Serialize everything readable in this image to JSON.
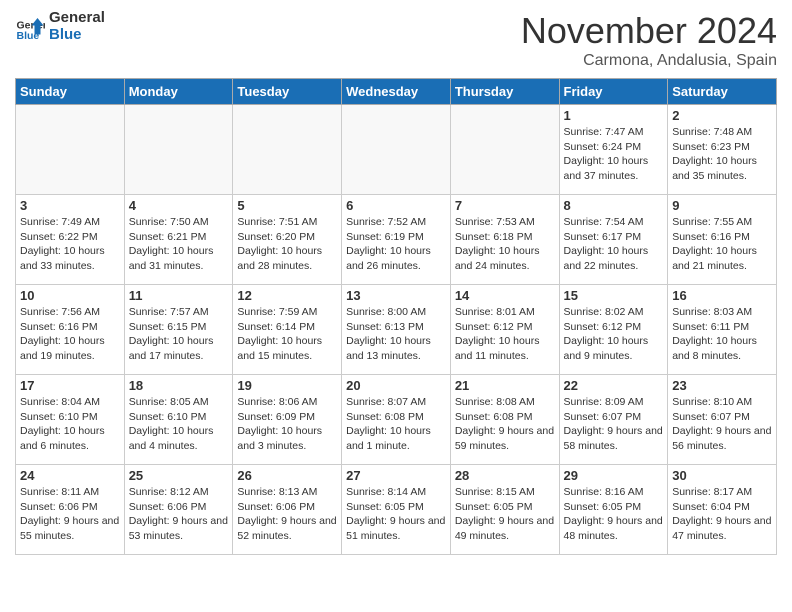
{
  "header": {
    "logo_line1": "General",
    "logo_line2": "Blue",
    "month_title": "November 2024",
    "location": "Carmona, Andalusia, Spain"
  },
  "weekdays": [
    "Sunday",
    "Monday",
    "Tuesday",
    "Wednesday",
    "Thursday",
    "Friday",
    "Saturday"
  ],
  "weeks": [
    [
      {
        "day": "",
        "info": "",
        "empty": true
      },
      {
        "day": "",
        "info": "",
        "empty": true
      },
      {
        "day": "",
        "info": "",
        "empty": true
      },
      {
        "day": "",
        "info": "",
        "empty": true
      },
      {
        "day": "",
        "info": "",
        "empty": true
      },
      {
        "day": "1",
        "info": "Sunrise: 7:47 AM\nSunset: 6:24 PM\nDaylight: 10 hours and 37 minutes.",
        "empty": false
      },
      {
        "day": "2",
        "info": "Sunrise: 7:48 AM\nSunset: 6:23 PM\nDaylight: 10 hours and 35 minutes.",
        "empty": false
      }
    ],
    [
      {
        "day": "3",
        "info": "Sunrise: 7:49 AM\nSunset: 6:22 PM\nDaylight: 10 hours and 33 minutes.",
        "empty": false
      },
      {
        "day": "4",
        "info": "Sunrise: 7:50 AM\nSunset: 6:21 PM\nDaylight: 10 hours and 31 minutes.",
        "empty": false
      },
      {
        "day": "5",
        "info": "Sunrise: 7:51 AM\nSunset: 6:20 PM\nDaylight: 10 hours and 28 minutes.",
        "empty": false
      },
      {
        "day": "6",
        "info": "Sunrise: 7:52 AM\nSunset: 6:19 PM\nDaylight: 10 hours and 26 minutes.",
        "empty": false
      },
      {
        "day": "7",
        "info": "Sunrise: 7:53 AM\nSunset: 6:18 PM\nDaylight: 10 hours and 24 minutes.",
        "empty": false
      },
      {
        "day": "8",
        "info": "Sunrise: 7:54 AM\nSunset: 6:17 PM\nDaylight: 10 hours and 22 minutes.",
        "empty": false
      },
      {
        "day": "9",
        "info": "Sunrise: 7:55 AM\nSunset: 6:16 PM\nDaylight: 10 hours and 21 minutes.",
        "empty": false
      }
    ],
    [
      {
        "day": "10",
        "info": "Sunrise: 7:56 AM\nSunset: 6:16 PM\nDaylight: 10 hours and 19 minutes.",
        "empty": false
      },
      {
        "day": "11",
        "info": "Sunrise: 7:57 AM\nSunset: 6:15 PM\nDaylight: 10 hours and 17 minutes.",
        "empty": false
      },
      {
        "day": "12",
        "info": "Sunrise: 7:59 AM\nSunset: 6:14 PM\nDaylight: 10 hours and 15 minutes.",
        "empty": false
      },
      {
        "day": "13",
        "info": "Sunrise: 8:00 AM\nSunset: 6:13 PM\nDaylight: 10 hours and 13 minutes.",
        "empty": false
      },
      {
        "day": "14",
        "info": "Sunrise: 8:01 AM\nSunset: 6:12 PM\nDaylight: 10 hours and 11 minutes.",
        "empty": false
      },
      {
        "day": "15",
        "info": "Sunrise: 8:02 AM\nSunset: 6:12 PM\nDaylight: 10 hours and 9 minutes.",
        "empty": false
      },
      {
        "day": "16",
        "info": "Sunrise: 8:03 AM\nSunset: 6:11 PM\nDaylight: 10 hours and 8 minutes.",
        "empty": false
      }
    ],
    [
      {
        "day": "17",
        "info": "Sunrise: 8:04 AM\nSunset: 6:10 PM\nDaylight: 10 hours and 6 minutes.",
        "empty": false
      },
      {
        "day": "18",
        "info": "Sunrise: 8:05 AM\nSunset: 6:10 PM\nDaylight: 10 hours and 4 minutes.",
        "empty": false
      },
      {
        "day": "19",
        "info": "Sunrise: 8:06 AM\nSunset: 6:09 PM\nDaylight: 10 hours and 3 minutes.",
        "empty": false
      },
      {
        "day": "20",
        "info": "Sunrise: 8:07 AM\nSunset: 6:08 PM\nDaylight: 10 hours and 1 minute.",
        "empty": false
      },
      {
        "day": "21",
        "info": "Sunrise: 8:08 AM\nSunset: 6:08 PM\nDaylight: 9 hours and 59 minutes.",
        "empty": false
      },
      {
        "day": "22",
        "info": "Sunrise: 8:09 AM\nSunset: 6:07 PM\nDaylight: 9 hours and 58 minutes.",
        "empty": false
      },
      {
        "day": "23",
        "info": "Sunrise: 8:10 AM\nSunset: 6:07 PM\nDaylight: 9 hours and 56 minutes.",
        "empty": false
      }
    ],
    [
      {
        "day": "24",
        "info": "Sunrise: 8:11 AM\nSunset: 6:06 PM\nDaylight: 9 hours and 55 minutes.",
        "empty": false
      },
      {
        "day": "25",
        "info": "Sunrise: 8:12 AM\nSunset: 6:06 PM\nDaylight: 9 hours and 53 minutes.",
        "empty": false
      },
      {
        "day": "26",
        "info": "Sunrise: 8:13 AM\nSunset: 6:06 PM\nDaylight: 9 hours and 52 minutes.",
        "empty": false
      },
      {
        "day": "27",
        "info": "Sunrise: 8:14 AM\nSunset: 6:05 PM\nDaylight: 9 hours and 51 minutes.",
        "empty": false
      },
      {
        "day": "28",
        "info": "Sunrise: 8:15 AM\nSunset: 6:05 PM\nDaylight: 9 hours and 49 minutes.",
        "empty": false
      },
      {
        "day": "29",
        "info": "Sunrise: 8:16 AM\nSunset: 6:05 PM\nDaylight: 9 hours and 48 minutes.",
        "empty": false
      },
      {
        "day": "30",
        "info": "Sunrise: 8:17 AM\nSunset: 6:04 PM\nDaylight: 9 hours and 47 minutes.",
        "empty": false
      }
    ]
  ]
}
